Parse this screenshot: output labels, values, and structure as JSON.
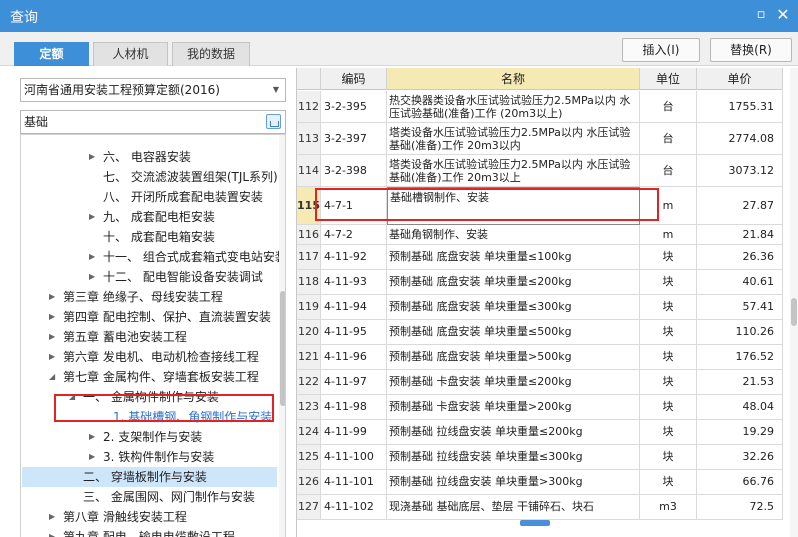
{
  "window": {
    "title": "查询"
  },
  "tabs": [
    {
      "label": "定额"
    },
    {
      "label": "人材机"
    },
    {
      "label": "我的数据"
    }
  ],
  "actions": {
    "insert": "插入(I)",
    "replace": "替换(R)"
  },
  "left": {
    "quota_select": "河南省通用安装工程预算定额(2016)",
    "search_value": "基础"
  },
  "tree": [
    {
      "label": "六、 电容器安装",
      "caret": "▶"
    },
    {
      "label": "七、 交流滤波装置组架(TJL系列)",
      "caret": ""
    },
    {
      "label": "八、 开闭所成套配电装置安装",
      "caret": ""
    },
    {
      "label": "九、 成套配电柜安装",
      "caret": "▶"
    },
    {
      "label": "十、 成套配电箱安装",
      "caret": ""
    },
    {
      "label": "十一、 组合式成套箱式变电站安装",
      "caret": "▶"
    },
    {
      "label": "十二、 配电智能设备安装调试",
      "caret": "▶"
    },
    {
      "label": "第三章 绝缘子、母线安装工程",
      "caret": "▶"
    },
    {
      "label": "第四章 配电控制、保护、直流装置安装",
      "caret": "▶"
    },
    {
      "label": "第五章 蓄电池安装工程",
      "caret": "▶"
    },
    {
      "label": "第六章 发电机、电动机检查接线工程",
      "caret": "▶"
    },
    {
      "label": "第七章 金属构件、穿墙套板安装工程",
      "caret": "◢"
    },
    {
      "label": "一、 金属构件制作与安装",
      "caret": "◢"
    },
    {
      "label": "1. 基础槽钢、角钢制作与安装",
      "caret": ""
    },
    {
      "label": "2. 支架制作与安装",
      "caret": "▶"
    },
    {
      "label": "3. 铁构件制作与安装",
      "caret": "▶"
    },
    {
      "label": "二、 穿墙板制作与安装",
      "caret": ""
    },
    {
      "label": "三、 金属围网、网门制作与安装",
      "caret": ""
    },
    {
      "label": "第八章 滑触线安装工程",
      "caret": "▶"
    },
    {
      "label": "第九章 配电、输电电缆敷设工程",
      "caret": "▶"
    }
  ],
  "grid": {
    "headers": {
      "code": "编码",
      "name": "名称",
      "unit": "单位",
      "price": "单价"
    },
    "rows": [
      {
        "num": "112",
        "code": "3-2-395",
        "name": "热交换器类设备水压试验试验压力2.5MPa以内 水压试验基础(准备)工作 (20m3以上)",
        "unit": "台",
        "price": "1755.31"
      },
      {
        "num": "113",
        "code": "3-2-397",
        "name": "塔类设备水压试验试验压力2.5MPa以内 水压试验基础(准备)工作 20m3以内",
        "unit": "台",
        "price": "2774.08"
      },
      {
        "num": "114",
        "code": "3-2-398",
        "name": "塔类设备水压试验试验压力2.5MPa以内 水压试验基础(准备)工作 20m3以上",
        "unit": "台",
        "price": "3073.12"
      },
      {
        "num": "115",
        "code": "4-7-1",
        "name": "基础槽钢制作、安装",
        "unit": "m",
        "price": "27.87"
      },
      {
        "num": "116",
        "code": "4-7-2",
        "name": "基础角钢制作、安装",
        "unit": "m",
        "price": "21.84"
      },
      {
        "num": "117",
        "code": "4-11-92",
        "name": "预制基础 底盘安装 单块重量≤100kg",
        "unit": "块",
        "price": "26.36"
      },
      {
        "num": "118",
        "code": "4-11-93",
        "name": "预制基础 底盘安装 单块重量≤200kg",
        "unit": "块",
        "price": "40.61"
      },
      {
        "num": "119",
        "code": "4-11-94",
        "name": "预制基础 底盘安装 单块重量≤300kg",
        "unit": "块",
        "price": "57.41"
      },
      {
        "num": "120",
        "code": "4-11-95",
        "name": "预制基础 底盘安装 单块重量≤500kg",
        "unit": "块",
        "price": "110.26"
      },
      {
        "num": "121",
        "code": "4-11-96",
        "name": "预制基础 底盘安装 单块重量>500kg",
        "unit": "块",
        "price": "176.52"
      },
      {
        "num": "122",
        "code": "4-11-97",
        "name": "预制基础 卡盘安装 单块重量≤200kg",
        "unit": "块",
        "price": "21.53"
      },
      {
        "num": "123",
        "code": "4-11-98",
        "name": "预制基础 卡盘安装 单块重量>200kg",
        "unit": "块",
        "price": "48.04"
      },
      {
        "num": "124",
        "code": "4-11-99",
        "name": "预制基础 拉线盘安装 单块重量≤200kg",
        "unit": "块",
        "price": "19.29"
      },
      {
        "num": "125",
        "code": "4-11-100",
        "name": "预制基础 拉线盘安装 单块重量≤300kg",
        "unit": "块",
        "price": "32.26"
      },
      {
        "num": "126",
        "code": "4-11-101",
        "name": "预制基础 拉线盘安装 单块重量>300kg",
        "unit": "块",
        "price": "66.76"
      },
      {
        "num": "127",
        "code": "4-11-102",
        "name": "现浇基础 基础底层、垫层 干铺碎石、块石",
        "unit": "m3",
        "price": "72.5"
      }
    ]
  },
  "colors": {
    "accent": "#3d8fd8",
    "highlight_box": "#e02424",
    "header_current": "#f5eab4",
    "tree_selected": "#cde6fa"
  }
}
